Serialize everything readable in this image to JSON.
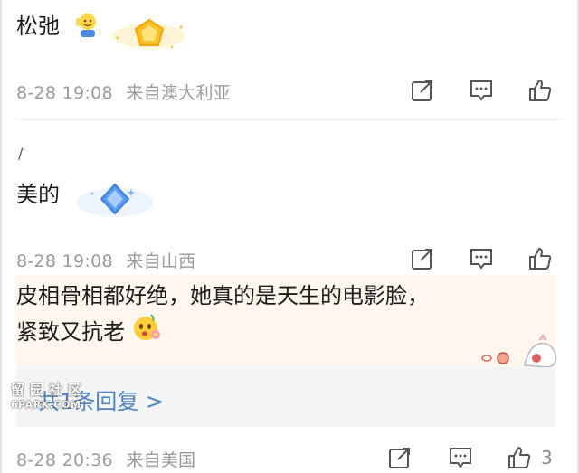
{
  "comments": [
    {
      "text": "松弛",
      "time": "8-28 19:08",
      "location": "来自澳大利亚",
      "badge_icon": "gold-pentagon-badge-icon",
      "emoji": "waving-person-emoji"
    },
    {
      "text": "美的",
      "time": "8-28 19:08",
      "location": "来自山西",
      "badge_icon": "blue-diamond-badge-icon"
    },
    {
      "text_line1": "皮相骨相都好绝，她真的是天生的电影脸，",
      "text_line2": "紧致又抗老",
      "emoji": "flower-smile-emoji",
      "time": "8-28 20:36",
      "location": "来自美国",
      "like_count": "3"
    }
  ],
  "reply_link": {
    "label": "共1条回复 >"
  },
  "watermark": {
    "line1": "留园社区",
    "line2": "6PARK.COM"
  },
  "colors": {
    "meta": "#9a9a9a",
    "link": "#4f7fbd",
    "highlight_bg": "#fff7ee",
    "reply_bg": "#f3f4f6"
  }
}
